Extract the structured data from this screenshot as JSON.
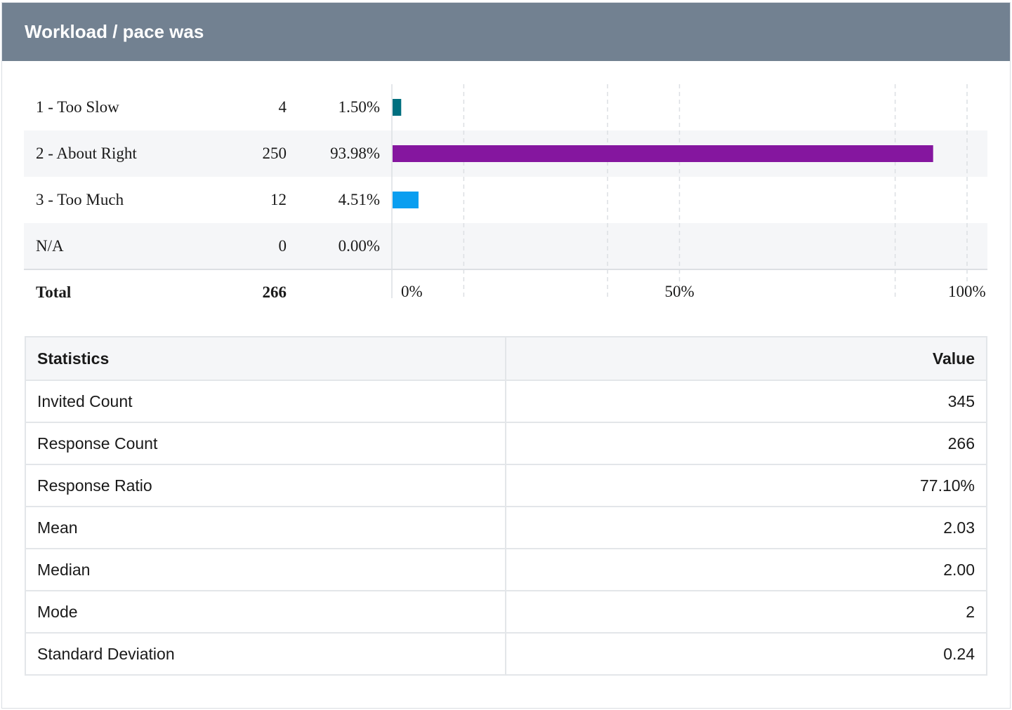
{
  "title": "Workload / pace was",
  "distribution": {
    "rows": [
      {
        "label": "1 - Too Slow",
        "count": "4",
        "percent": "1.50%"
      },
      {
        "label": "2 - About Right",
        "count": "250",
        "percent": "93.98%"
      },
      {
        "label": "3 - Too Much",
        "count": "12",
        "percent": "4.51%"
      },
      {
        "label": "N/A",
        "count": "0",
        "percent": "0.00%"
      }
    ],
    "total": {
      "label": "Total",
      "count": "266"
    }
  },
  "chart_data": {
    "type": "bar",
    "orientation": "horizontal",
    "categories": [
      "1 - Too Slow",
      "2 - About Right",
      "3 - Too Much",
      "N/A"
    ],
    "values": [
      1.5,
      93.98,
      4.51,
      0.0
    ],
    "colors": [
      "#006f7f",
      "#85169f",
      "#0a9ef0",
      "#999999"
    ],
    "xlim": [
      0,
      100
    ],
    "xticks": [
      "0%",
      "50%",
      "100%"
    ],
    "grid": true,
    "legend": "none"
  },
  "stats": {
    "header": {
      "name": "Statistics",
      "value": "Value"
    },
    "rows": [
      {
        "name": "Invited Count",
        "value": "345"
      },
      {
        "name": "Response Count",
        "value": "266"
      },
      {
        "name": "Response Ratio",
        "value": "77.10%"
      },
      {
        "name": "Mean",
        "value": "2.03"
      },
      {
        "name": "Median",
        "value": "2.00"
      },
      {
        "name": "Mode",
        "value": "2"
      },
      {
        "name": "Standard Deviation",
        "value": "0.24"
      }
    ]
  }
}
